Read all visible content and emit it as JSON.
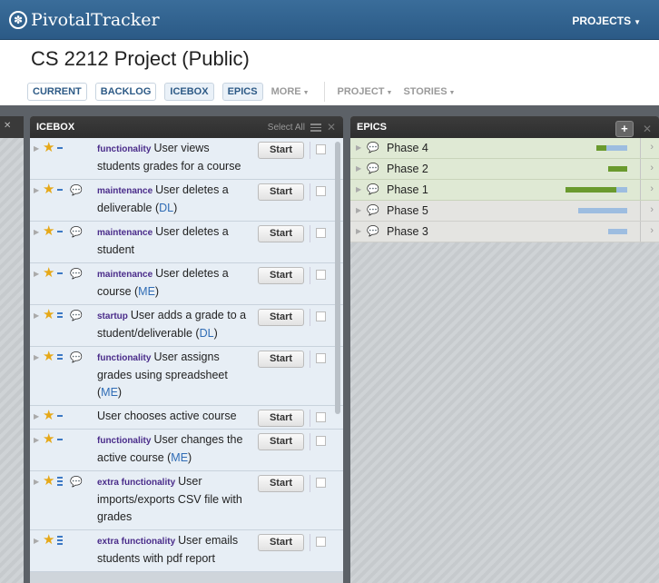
{
  "topbar": {
    "logo_text": "PivotalTracker",
    "projects_label": "PROJECTS"
  },
  "project": {
    "title": "CS 2212 Project (Public)"
  },
  "nav": {
    "current": "CURRENT",
    "backlog": "BACKLOG",
    "icebox": "ICEBOX",
    "epics": "EPICS",
    "more": "MORE",
    "project": "PROJECT",
    "stories": "STORIES"
  },
  "icebox": {
    "title": "ICEBOX",
    "select_all": "Select All",
    "start_label": "Start",
    "stories": [
      {
        "label": "functionality",
        "text": "User views students grades for a course",
        "owner": "",
        "points": 1,
        "comment": false
      },
      {
        "label": "maintenance",
        "text": "User deletes a deliverable",
        "owner": "DL",
        "points": 1,
        "comment": true
      },
      {
        "label": "maintenance",
        "text": "User deletes a student",
        "owner": "",
        "points": 1,
        "comment": true
      },
      {
        "label": "maintenance",
        "text": "User deletes a course",
        "owner": "ME",
        "points": 1,
        "comment": true
      },
      {
        "label": "startup",
        "text": "User adds a grade to a student/deliverable",
        "owner": "DL",
        "points": 2,
        "comment": true
      },
      {
        "label": "functionality",
        "text": "User assigns grades using spreadsheet",
        "owner": "ME",
        "points": 2,
        "comment": true
      },
      {
        "label": "",
        "text": "User chooses active course",
        "owner": "",
        "points": 1,
        "comment": false
      },
      {
        "label": "functionality",
        "text": "User changes the active course",
        "owner": "ME",
        "points": 1,
        "comment": false
      },
      {
        "label": "extra functionality",
        "text": "User imports/exports CSV file with grades",
        "owner": "",
        "points": 3,
        "comment": true
      },
      {
        "label": "extra functionality",
        "text": "User emails students with pdf report",
        "owner": "",
        "points": 3,
        "comment": false
      }
    ]
  },
  "epics": {
    "title": "EPICS",
    "add_label": "+",
    "items": [
      {
        "name": "Phase 4",
        "done": 0.15,
        "total": 0.45,
        "style": "green"
      },
      {
        "name": "Phase 2",
        "done": 0.28,
        "total": 0.28,
        "style": "green"
      },
      {
        "name": "Phase 1",
        "done": 0.75,
        "total": 0.9,
        "style": "green"
      },
      {
        "name": "Phase 5",
        "done": 0,
        "total": 0.72,
        "style": "neutral"
      },
      {
        "name": "Phase 3",
        "done": 0,
        "total": 0.28,
        "style": "neutral"
      }
    ]
  },
  "colors": {
    "topbar": "#2f6190",
    "accepted_bar": "#6a9a2e",
    "unstarted_bar": "#9dbde0",
    "label_purple": "#4a2c8a",
    "owner_blue": "#2f6cb5",
    "star": "#e6a817"
  }
}
